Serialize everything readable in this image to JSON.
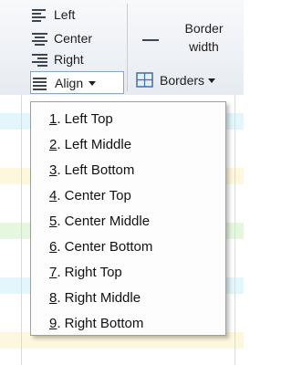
{
  "ribbon": {
    "align_left_label": "Left",
    "align_center_label": "Center",
    "align_right_label": "Right",
    "align_button_label": "Align",
    "border_width_label_line1": "Border",
    "border_width_label_line2": "width",
    "borders_button_label": "Borders"
  },
  "menu": {
    "items": [
      {
        "key": "1",
        "rest": ". Left Top"
      },
      {
        "key": "2",
        "rest": ". Left Middle"
      },
      {
        "key": "3",
        "rest": ". Left Bottom"
      },
      {
        "key": "4",
        "rest": ". Center Top"
      },
      {
        "key": "5",
        "rest": ". Center Middle"
      },
      {
        "key": "6",
        "rest": ". Center Bottom"
      },
      {
        "key": "7",
        "rest": ". Right Top"
      },
      {
        "key": "8",
        "rest": ". Right Middle"
      },
      {
        "key": "9",
        "rest": ". Right Bottom"
      }
    ]
  },
  "colors": {
    "row_cyan": "#e2f6fb",
    "row_yellow": "#fdf8dd",
    "row_green": "#e6f7df",
    "borders_icon": "#3d6fa8"
  }
}
